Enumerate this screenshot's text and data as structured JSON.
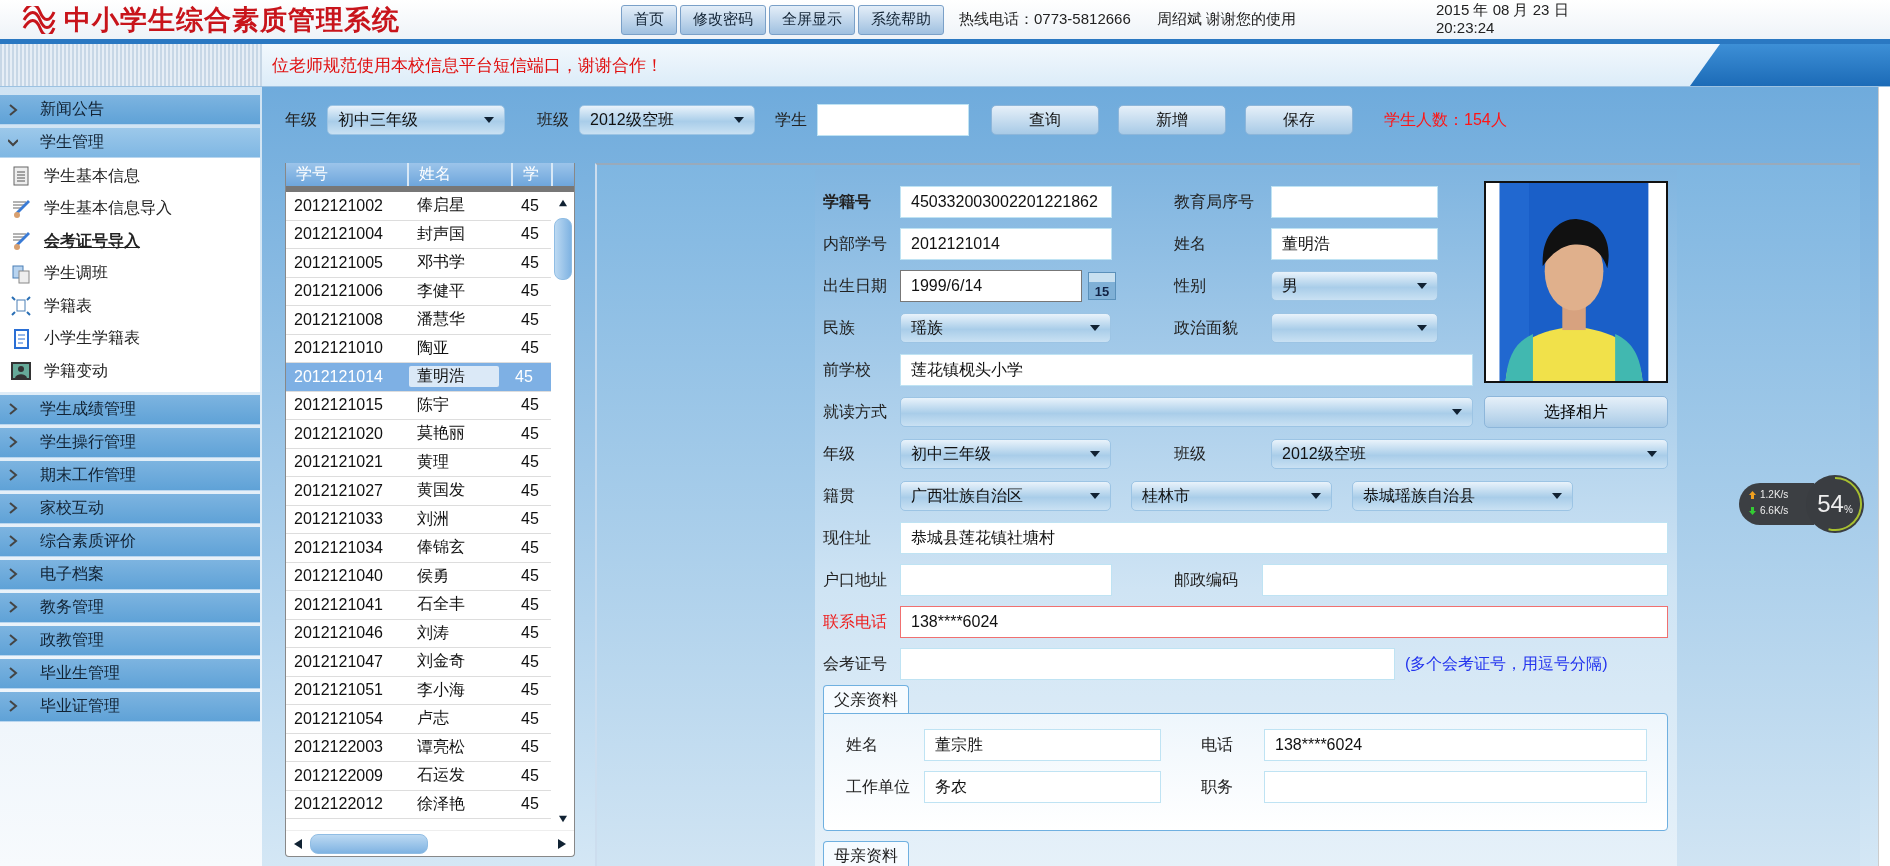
{
  "header": {
    "logo_text": "中小学生综合素质管理系统",
    "nav": [
      {
        "label": "首页"
      },
      {
        "label": "修改密码"
      },
      {
        "label": "全屏显示"
      },
      {
        "label": "系统帮助"
      }
    ],
    "hotline": "热线电话：0773-5812666",
    "user": "周绍斌  谢谢您的使用",
    "date": "2015 年 08 月 23 日",
    "time": "20:23:24"
  },
  "notice": "位老师规范使用本校信息平台短信端口，谢谢合作！",
  "sidebar": [
    {
      "label": "新闻公告",
      "expanded": false
    },
    {
      "label": "学生管理",
      "expanded": true,
      "children": [
        {
          "label": "学生基本信息",
          "kind": "list",
          "selected": false
        },
        {
          "label": "学生基本信息导入",
          "kind": "import",
          "selected": false
        },
        {
          "label": "会考证号导入",
          "kind": "import",
          "selected": true
        },
        {
          "label": "学生调班",
          "kind": "copy",
          "selected": false
        },
        {
          "label": "学籍表",
          "kind": "frame",
          "selected": false
        },
        {
          "label": "小学生学籍表",
          "kind": "doc",
          "selected": false
        },
        {
          "label": "学籍变动",
          "kind": "person",
          "selected": false
        }
      ]
    },
    {
      "label": "学生成绩管理",
      "expanded": false
    },
    {
      "label": "学生操行管理",
      "expanded": false
    },
    {
      "label": "期末工作管理",
      "expanded": false
    },
    {
      "label": "家校互动",
      "expanded": false
    },
    {
      "label": "综合素质评价",
      "expanded": false
    },
    {
      "label": "电子档案",
      "expanded": false
    },
    {
      "label": "教务管理",
      "expanded": false
    },
    {
      "label": "政教管理",
      "expanded": false
    },
    {
      "label": "毕业生管理",
      "expanded": false
    },
    {
      "label": "毕业证管理",
      "expanded": false
    }
  ],
  "filter": {
    "grade_label": "年级",
    "grade": "初中三年级",
    "class_label": "班级",
    "class": "2012级空班",
    "student_label": "学生",
    "buttons": [
      "查询",
      "新增",
      "保存"
    ],
    "count": "学生人数：154人"
  },
  "table": {
    "columns": [
      "学号",
      "姓名",
      "学"
    ],
    "rows": [
      {
        "id": "2012121002",
        "name": "俸启星",
        "column_3": "45",
        "selected": false
      },
      {
        "id": "2012121004",
        "name": "封声国",
        "column_3": "45",
        "selected": false
      },
      {
        "id": "2012121005",
        "name": "邓书学",
        "column_3": "45",
        "selected": false
      },
      {
        "id": "2012121006",
        "name": "李健平",
        "column_3": "45",
        "selected": false
      },
      {
        "id": "2012121008",
        "name": "潘慧华",
        "column_3": "45",
        "selected": false
      },
      {
        "id": "2012121010",
        "name": "陶亚",
        "column_3": "45",
        "selected": false
      },
      {
        "id": "2012121014",
        "name": "董明浩",
        "column_3": "45",
        "selected": true
      },
      {
        "id": "2012121015",
        "name": "陈宇",
        "column_3": "45",
        "selected": false
      },
      {
        "id": "2012121020",
        "name": "莫艳丽",
        "column_3": "45",
        "selected": false
      },
      {
        "id": "2012121021",
        "name": "黄理",
        "column_3": "45",
        "selected": false
      },
      {
        "id": "2012121027",
        "name": "黄国发",
        "column_3": "45",
        "selected": false
      },
      {
        "id": "2012121033",
        "name": "刘洲",
        "column_3": "45",
        "selected": false
      },
      {
        "id": "2012121034",
        "name": "俸锦玄",
        "column_3": "45",
        "selected": false
      },
      {
        "id": "2012121040",
        "name": "侯勇",
        "column_3": "45",
        "selected": false
      },
      {
        "id": "2012121041",
        "name": "石全丰",
        "column_3": "45",
        "selected": false
      },
      {
        "id": "2012121046",
        "name": "刘涛",
        "column_3": "45",
        "selected": false
      },
      {
        "id": "2012121047",
        "name": "刘金奇",
        "column_3": "45",
        "selected": false
      },
      {
        "id": "2012121051",
        "name": "李小海",
        "column_3": "45",
        "selected": false
      },
      {
        "id": "2012121054",
        "name": "卢志",
        "column_3": "45",
        "selected": false
      },
      {
        "id": "2012122003",
        "name": "谭亮松",
        "column_3": "45",
        "selected": false
      },
      {
        "id": "2012122009",
        "name": "石运发",
        "column_3": "45",
        "selected": false
      },
      {
        "id": "2012122012",
        "name": "徐泽艳",
        "column_3": "45",
        "selected": false
      }
    ]
  },
  "form": {
    "student_no": {
      "label": "学籍号",
      "value": "450332003002201221862"
    },
    "bureau_no": {
      "label": "教育局序号"
    },
    "internal_no": {
      "label": "内部学号",
      "value": "2012121014"
    },
    "name": {
      "label": "姓名",
      "value": "董明浩"
    },
    "birth": {
      "label": "出生日期",
      "value": "1999/6/14",
      "calendar": "15"
    },
    "gender": {
      "label": "性别",
      "value": "男"
    },
    "ethnicity": {
      "label": "民族",
      "value": "瑶族"
    },
    "politics": {
      "label": "政治面貌"
    },
    "prev_school": {
      "label": "前学校",
      "value": "莲花镇枧头小学"
    },
    "study_mode": {
      "label": "就读方式"
    },
    "photo": {
      "kind": "picture",
      "button": "选择相片"
    },
    "grade": {
      "label": "年级",
      "value": "初中三年级"
    },
    "class": {
      "label": "班级",
      "value": "2012级空班"
    },
    "origin": {
      "label": "籍贯",
      "province": "广西壮族自治区",
      "city": "桂林市",
      "county": "恭城瑶族自治县"
    },
    "address": {
      "label": "现住址",
      "value": "恭城县莲花镇社塘村"
    },
    "hukou": {
      "label": "户口地址"
    },
    "postcode": {
      "label": "邮政编码"
    },
    "phone": {
      "label": "联系电话",
      "value": "138****6024",
      "required": true
    },
    "exam_no": {
      "label": "会考证号",
      "note": "(多个会考证号，用逗号分隔)"
    }
  },
  "father": {
    "tab": "父亲资料",
    "name_label": "姓名",
    "name": "董宗胜",
    "phone_label": "电话",
    "phone": "138****6024",
    "work_label": "工作单位",
    "work": "务农",
    "post_label": "职务"
  },
  "mother": {
    "tab": "母亲资料"
  },
  "net_widget": {
    "up": "1.2",
    "up_unit": "K/s",
    "down": "6.6",
    "down_unit": "K/s",
    "percent": "54",
    "percent_sign": "%",
    "level": 0.54
  }
}
